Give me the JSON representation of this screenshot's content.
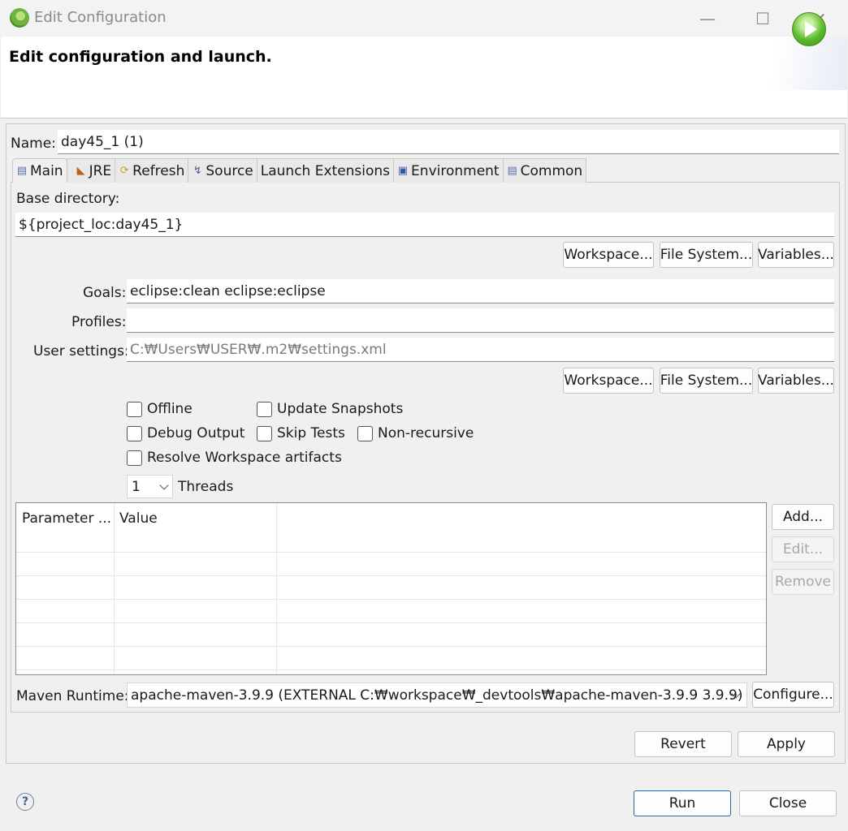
{
  "window": {
    "title": "Edit Configuration",
    "controls": {
      "minimize": "—",
      "maximize": "☐",
      "close": "✕"
    }
  },
  "header": {
    "title": "Edit configuration and launch."
  },
  "name": {
    "label": "Name:",
    "value": "day45_1 (1)"
  },
  "tabs": [
    {
      "label": "Main",
      "icon": "page-icon",
      "glyph": "▤"
    },
    {
      "label": "JRE",
      "icon": "jre-icon",
      "glyph": "◣"
    },
    {
      "label": "Refresh",
      "icon": "refresh-icon",
      "glyph": "⟳"
    },
    {
      "label": "Source",
      "icon": "source-icon",
      "glyph": "↯"
    },
    {
      "label": "Launch Extensions",
      "icon": "",
      "glyph": ""
    },
    {
      "label": "Environment",
      "icon": "environment-icon",
      "glyph": "▣"
    },
    {
      "label": "Common",
      "icon": "common-icon",
      "glyph": "▤"
    }
  ],
  "main": {
    "base_dir_label": "Base directory:",
    "base_dir_value": "${project_loc:day45_1}",
    "buttons1": {
      "workspace": "Workspace...",
      "file_system": "File System...",
      "variables": "Variables..."
    },
    "goals_label": "Goals:",
    "goals_value": "eclipse:clean eclipse:eclipse",
    "profiles_label": "Profiles:",
    "profiles_value": "",
    "user_settings_label": "User settings:",
    "user_settings_value": "C:₩Users₩USER₩.m2₩settings.xml",
    "buttons2": {
      "workspace": "Workspace...",
      "file_system": "File System...",
      "variables": "Variables..."
    },
    "checkboxes": {
      "offline": "Offline",
      "update_snapshots": "Update Snapshots",
      "debug_output": "Debug Output",
      "skip_tests": "Skip Tests",
      "non_recursive": "Non-recursive",
      "resolve_workspace": "Resolve Workspace artifacts"
    },
    "threads_value": "1",
    "threads_label": "Threads",
    "params_table": {
      "col1": "Parameter ...",
      "col2": "Value"
    },
    "param_buttons": {
      "add": "Add...",
      "edit": "Edit...",
      "remove": "Remove"
    },
    "runtime_label": "Maven Runtime:",
    "runtime_value": "apache-maven-3.9.9 (EXTERNAL C:₩workspace₩_devtools₩apache-maven-3.9.9 3.9.9)",
    "configure": "Configure..."
  },
  "actions": {
    "revert": "Revert",
    "apply": "Apply",
    "run": "Run",
    "close": "Close"
  },
  "help": {
    "glyph": "?"
  }
}
